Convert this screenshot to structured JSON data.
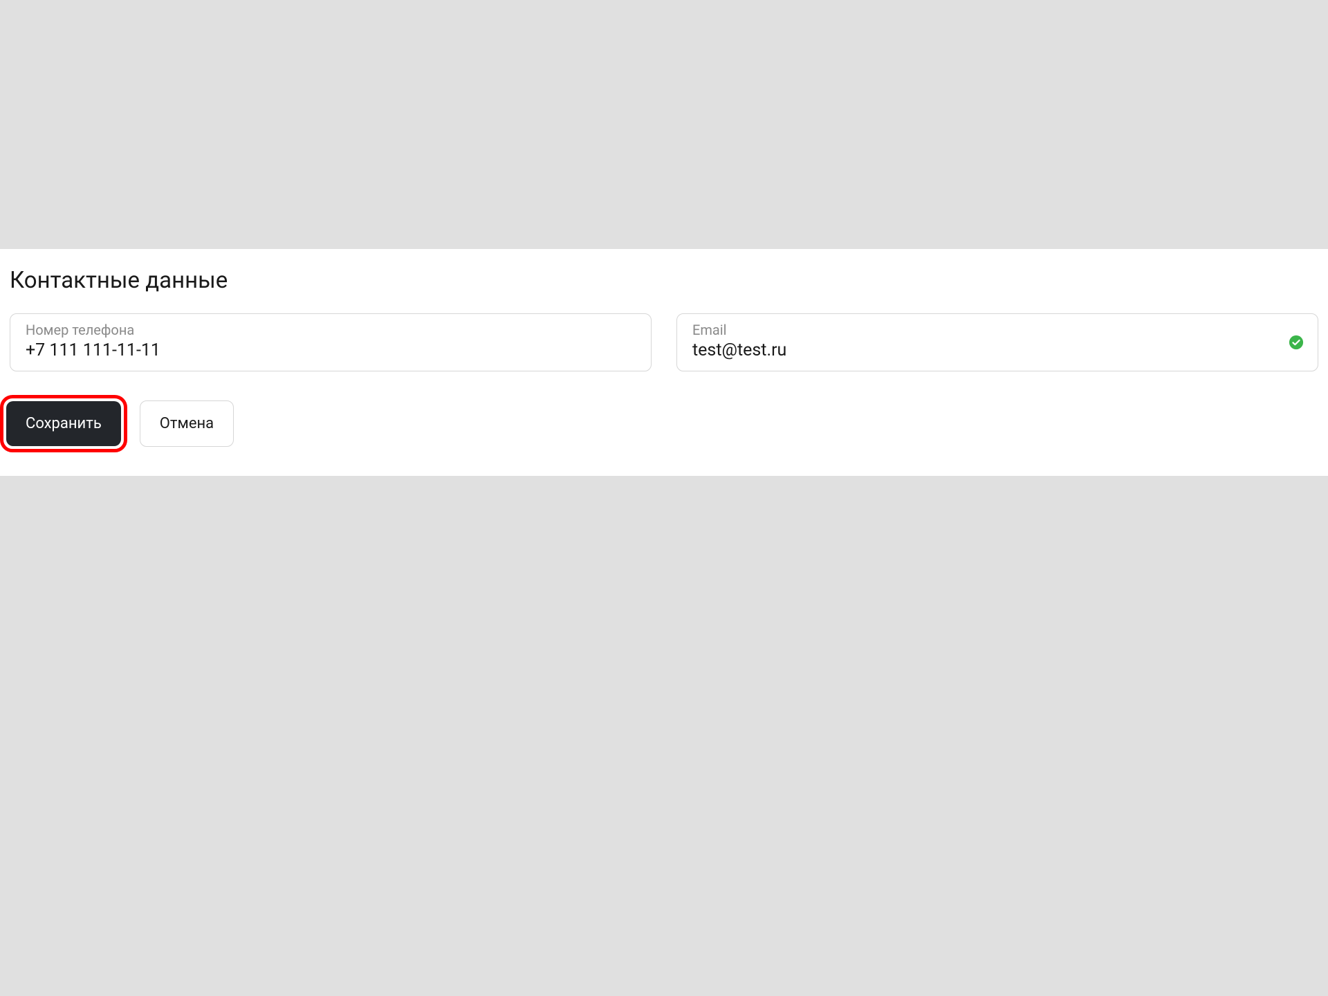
{
  "section": {
    "title": "Контактные данные"
  },
  "fields": {
    "phone": {
      "label": "Номер телефона",
      "value": "+7 111 111-11-11"
    },
    "email": {
      "label": "Email",
      "value": "test@test.ru",
      "valid": true
    }
  },
  "actions": {
    "save_label": "Сохранить",
    "cancel_label": "Отмена"
  }
}
